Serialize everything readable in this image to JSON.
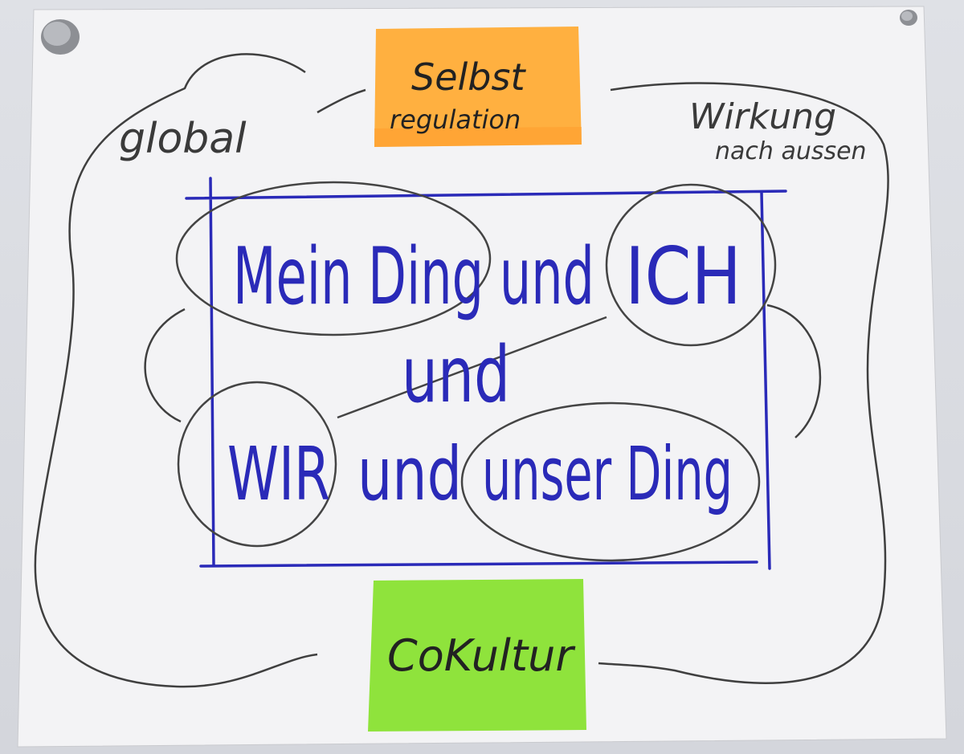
{
  "labels": {
    "top_left": "global",
    "top_right_line1": "Wirkung",
    "top_right_line2": "nach aussen"
  },
  "sticky_notes": {
    "top": {
      "line1": "Selbst",
      "line2": "regulation",
      "color": "#ffb040"
    },
    "bottom": {
      "text": "CoKultur",
      "color": "#8fe33c"
    }
  },
  "center": {
    "line1_part1": "Mein Ding und",
    "line1_part2": "ICH",
    "line2": "und",
    "line3_part1": "WIR",
    "line3_part2": "und",
    "line3_part3": "unser Ding",
    "ink_color": "#2a2ab8"
  },
  "colors": {
    "paper": "#f3f3f5",
    "marker_dark": "#3a3a3a",
    "marker_blue": "#2a2ab8"
  },
  "icons": [
    "magnet-pin-icon"
  ]
}
